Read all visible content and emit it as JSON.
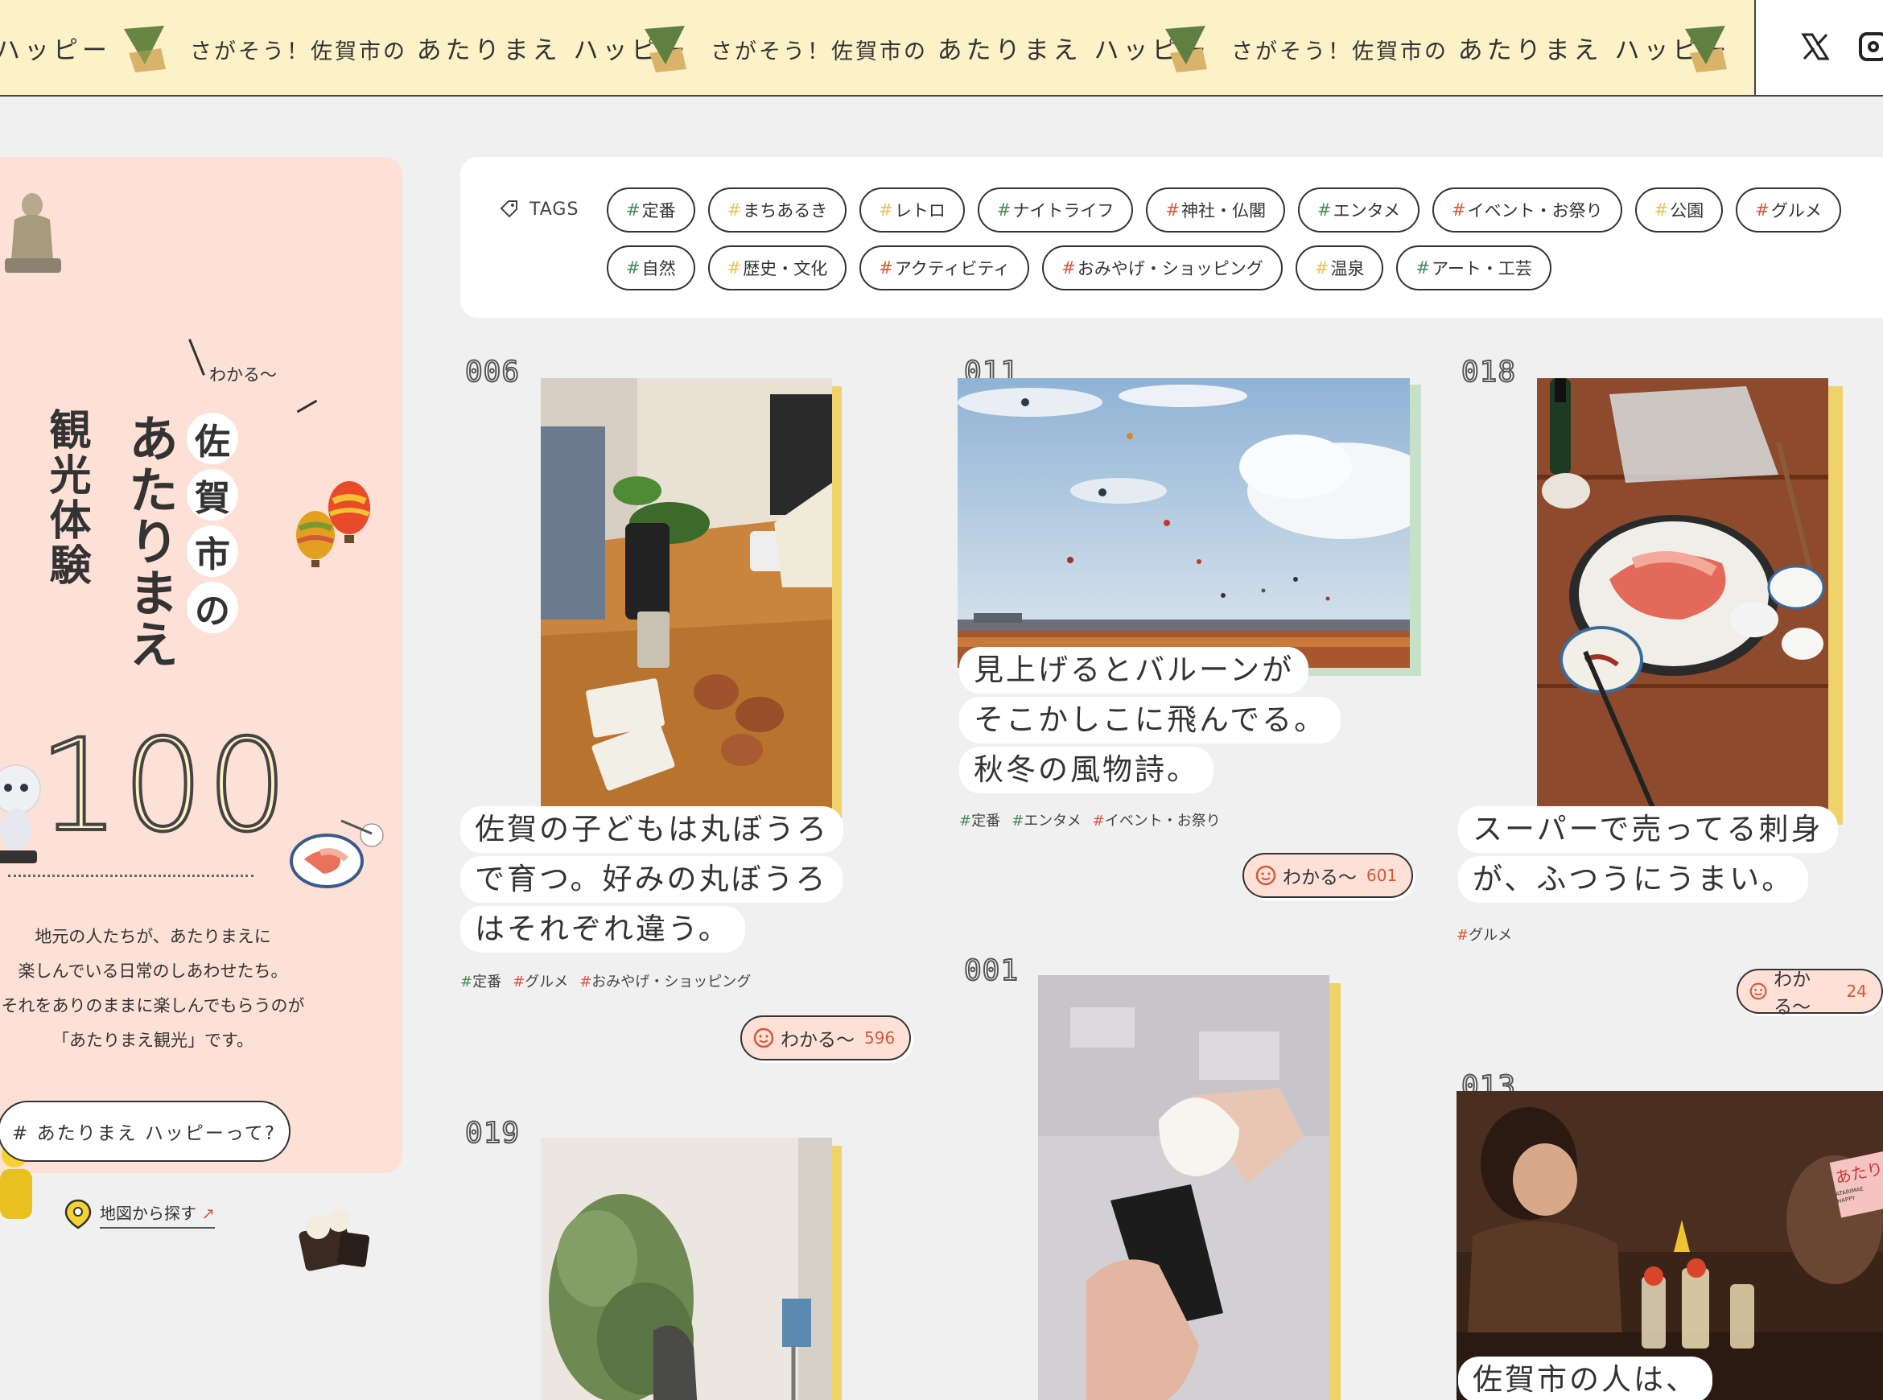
{
  "marquee": {
    "text_small": "さがそう！佐賀市の",
    "text_big": "あたりまえ ハッピー",
    "partial": "ハッピー"
  },
  "social": {
    "x_icon": "x-logo-icon",
    "instagram_icon": "instagram-icon"
  },
  "sidebar": {
    "catch": "わかる〜",
    "title_city": [
      "佐",
      "賀",
      "市",
      "の"
    ],
    "title_main": "あたりまえ",
    "title_sub": "観光体験",
    "number": "100",
    "description": [
      "地元の人たちが、あたりまえに",
      "楽しんでいる日常のしあわせたち。",
      "それをありのままに楽しんでもらうのが",
      "「あたりまえ観光」です。"
    ],
    "happy_button": "# あたりまえ ハッピーって?",
    "map_link": "地図から探す",
    "map_link_arrow": "↗"
  },
  "tags_panel": {
    "heading": "TAGS",
    "tags": [
      {
        "label": "定番",
        "hash_color": "#4a8a5a"
      },
      {
        "label": "まちあるき",
        "hash_color": "#e8c25a"
      },
      {
        "label": "レトロ",
        "hash_color": "#e8c25a"
      },
      {
        "label": "ナイトライフ",
        "hash_color": "#4a8a5a"
      },
      {
        "label": "神社・仏閣",
        "hash_color": "#d4583a"
      },
      {
        "label": "エンタメ",
        "hash_color": "#4a8a5a"
      },
      {
        "label": "イベント・お祭り",
        "hash_color": "#d4583a"
      },
      {
        "label": "公園",
        "hash_color": "#e8c25a"
      },
      {
        "label": "グルメ",
        "hash_color": "#d4583a"
      },
      {
        "label": "自然",
        "hash_color": "#4a8a5a"
      },
      {
        "label": "歴史・文化",
        "hash_color": "#e8c25a"
      },
      {
        "label": "アクティビティ",
        "hash_color": "#d4583a"
      },
      {
        "label": "おみやげ・ショッピング",
        "hash_color": "#d4583a"
      },
      {
        "label": "温泉",
        "hash_color": "#e8c25a"
      },
      {
        "label": "アート・工芸",
        "hash_color": "#4a8a5a"
      }
    ]
  },
  "cards": {
    "c006": {
      "number": "006",
      "caption": [
        "佐賀の子どもは丸ぼうろ",
        "で育つ。好みの丸ぼうろ",
        "はそれぞれ違う。"
      ],
      "tags": [
        "定番",
        "グルメ",
        "おみやげ・ショッピング"
      ],
      "wakaru": "わかる〜",
      "count": "596"
    },
    "c011": {
      "number": "011",
      "caption": [
        "見上げるとバルーンが",
        "そこかしこに飛んでる。",
        "秋冬の風物詩。"
      ],
      "tags": [
        "定番",
        "エンタメ",
        "イベント・お祭り"
      ],
      "wakaru": "わかる〜",
      "count": "601"
    },
    "c018": {
      "number": "018",
      "caption": [
        "スーパーで売ってる刺身",
        "が、ふつうにうまい。"
      ],
      "tags": [
        "グルメ"
      ],
      "wakaru": "わかる〜",
      "count": "24"
    },
    "c001": {
      "number": "001"
    },
    "c019": {
      "number": "019"
    },
    "c013": {
      "number": "013",
      "caption": [
        "佐賀市の人は、"
      ],
      "photo_label_big": "あたり",
      "photo_label_small": "ATARIMAE HAPPY"
    }
  },
  "colors": {
    "marquee_bg": "#fdf1c8",
    "sidebar_bg": "#fde0d6",
    "accent_red": "#d4583a",
    "accent_green": "#4a8a5a",
    "accent_yellow": "#e8c25a"
  }
}
